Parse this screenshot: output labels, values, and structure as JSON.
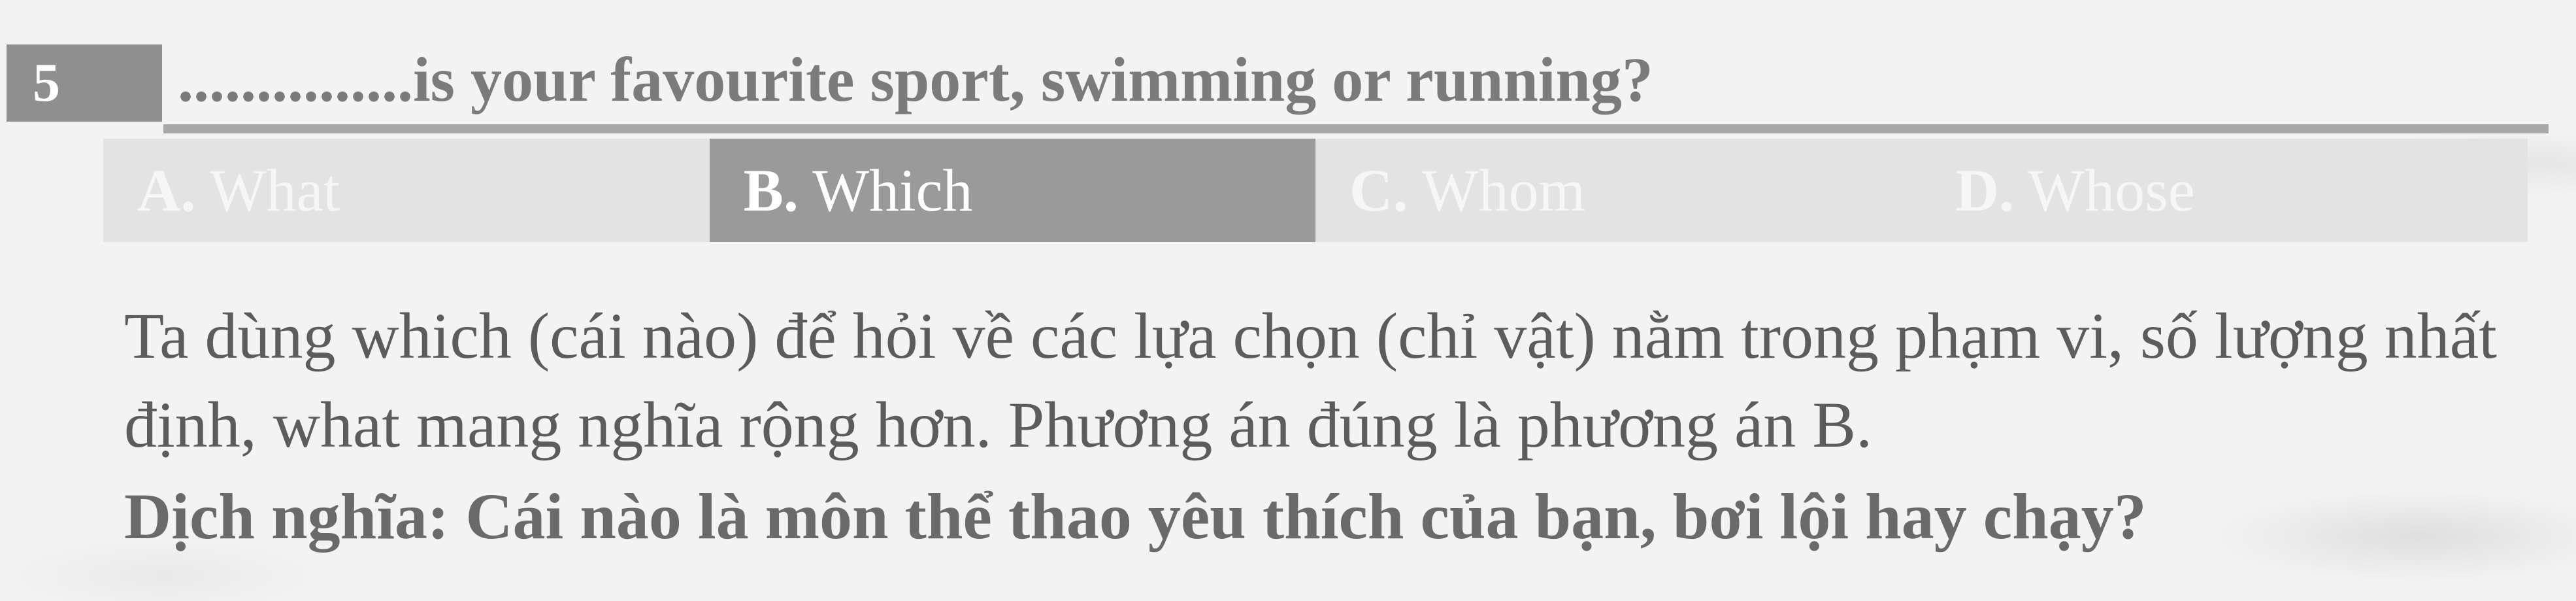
{
  "question": {
    "number": "5",
    "text": "...............is your favourite sport, swimming or running?"
  },
  "options": [
    {
      "letter": "A.",
      "text": "What",
      "selected": false
    },
    {
      "letter": "B.",
      "text": "Which",
      "selected": true
    },
    {
      "letter": "C.",
      "text": "Whom",
      "selected": false
    },
    {
      "letter": "D.",
      "text": "Whose",
      "selected": false
    }
  ],
  "explanation": "Ta dùng which (cái nào) để hỏi về các lựa chọn (chỉ vật) nằm trong phạm vi, số lượng nhất định, what mang nghĩa rộng hơn. Phương án đúng là phương án B.",
  "translation": "Dịch nghĩa: Cái nào là môn thể thao yêu thích của bạn, bơi lội hay chạy?",
  "colors": {
    "number_box": "#8f8f8f",
    "selected_option": "#9a9a9a",
    "option_bg": "#e3e3e3",
    "page_bg": "#f3f3f3"
  }
}
